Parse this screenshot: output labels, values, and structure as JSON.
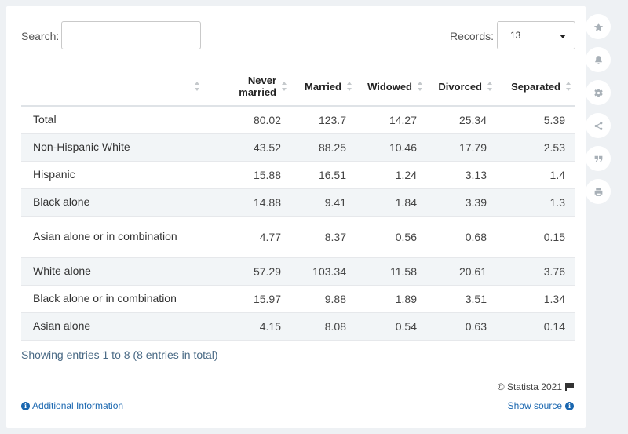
{
  "search": {
    "label": "Search:",
    "value": "",
    "placeholder": ""
  },
  "records": {
    "label": "Records:",
    "selected": "13"
  },
  "table": {
    "columns": [
      "",
      "Never married",
      "Married",
      "Widowed",
      "Divorced",
      "Separated"
    ],
    "rows": [
      {
        "label": "Total",
        "values": [
          "80.02",
          "123.7",
          "14.27",
          "25.34",
          "5.39"
        ]
      },
      {
        "label": "Non-Hispanic White",
        "values": [
          "43.52",
          "88.25",
          "10.46",
          "17.79",
          "2.53"
        ]
      },
      {
        "label": "Hispanic",
        "values": [
          "15.88",
          "16.51",
          "1.24",
          "3.13",
          "1.4"
        ]
      },
      {
        "label": "Black alone",
        "values": [
          "14.88",
          "9.41",
          "1.84",
          "3.39",
          "1.3"
        ]
      },
      {
        "label": "Asian alone or in combination",
        "values": [
          "4.77",
          "8.37",
          "0.56",
          "0.68",
          "0.15"
        ]
      },
      {
        "label": "White alone",
        "values": [
          "57.29",
          "103.34",
          "11.58",
          "20.61",
          "3.76"
        ]
      },
      {
        "label": "Black alone or in combination",
        "values": [
          "15.97",
          "9.88",
          "1.89",
          "3.51",
          "1.34"
        ]
      },
      {
        "label": "Asian alone",
        "values": [
          "4.15",
          "8.08",
          "0.54",
          "0.63",
          "0.14"
        ]
      }
    ]
  },
  "footer": {
    "showing": "Showing entries 1 to 8 (8 entries in total)",
    "copyright": "© Statista 2021",
    "additional_info": "Additional Information",
    "show_source": "Show source",
    "info_glyph": "i"
  },
  "sidebar_icons": [
    "star-icon",
    "bell-icon",
    "gear-icon",
    "share-icon",
    "quote-icon",
    "print-icon"
  ],
  "colors": {
    "link": "#1a67b0",
    "stripe": "#f2f5f7",
    "background": "#eef1f4"
  }
}
